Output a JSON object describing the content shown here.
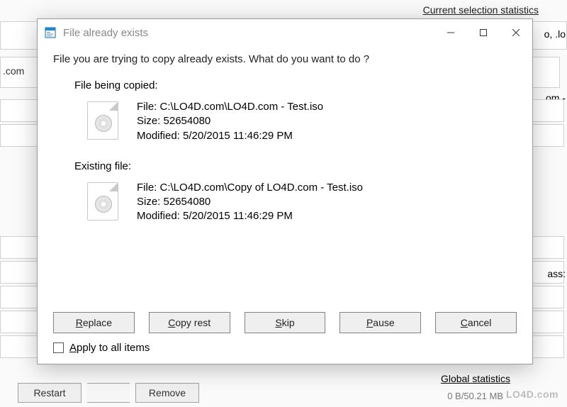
{
  "background": {
    "stats_heading": "Current selection statistics",
    "right_frag1": "o, .lo",
    "right_frag2": "om -",
    "right_frag3": "ass:",
    "com_label": ".com",
    "global_heading": "Global statistics",
    "global_sub": "0 B/50.21 MB",
    "buttons": {
      "restart": "Restart",
      "remove": "Remove"
    },
    "watermark": "LO4D.com"
  },
  "dialog": {
    "title": "File already exists",
    "prompt": "File you are trying to copy already exists. What do you want to do ?",
    "copied_label": "File being copied:",
    "existing_label": "Existing file:",
    "copied": {
      "file_label": "File:",
      "file": "C:\\LO4D.com\\LO4D.com - Test.iso",
      "size_label": "Size:",
      "size": "52654080",
      "modified_label": "Modified:",
      "modified": "5/20/2015 11:46:29 PM"
    },
    "existing": {
      "file_label": "File:",
      "file": "C:\\LO4D.com\\Copy of LO4D.com - Test.iso",
      "size_label": "Size:",
      "size": "52654080",
      "modified_label": "Modified:",
      "modified": "5/20/2015 11:46:29 PM"
    },
    "buttons": {
      "replace": "Replace",
      "copy_rest": "Copy rest",
      "skip": "Skip",
      "pause": "Pause",
      "cancel": "Cancel"
    },
    "apply_all": "Apply to all items"
  }
}
